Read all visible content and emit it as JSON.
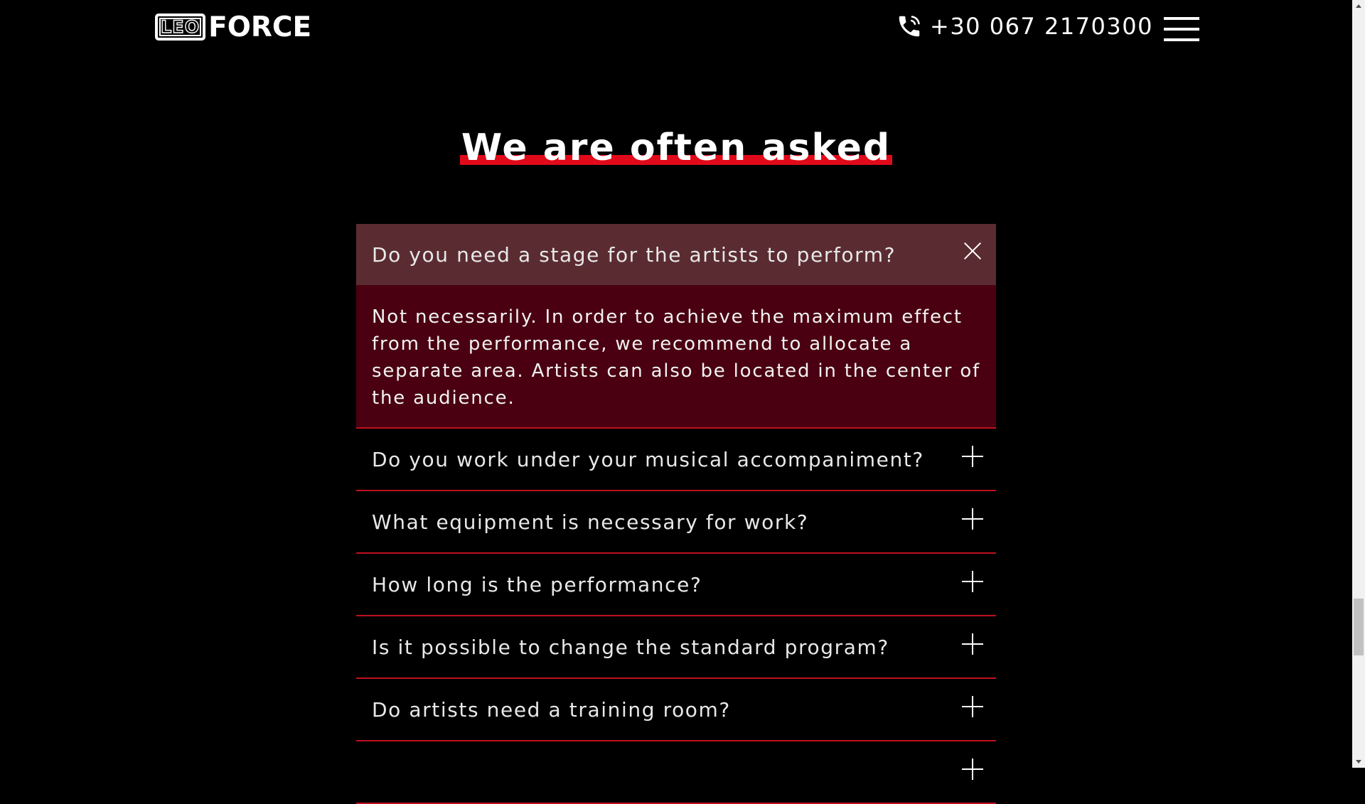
{
  "header": {
    "logo_left": "LEO",
    "logo_right": "FORCE",
    "phone": "+30 067 2170300"
  },
  "section": {
    "title": "We are often asked"
  },
  "faq": [
    {
      "question": "Do you need a stage for the artists to perform?",
      "answer": "Not necessarily. In order to achieve the maximum effect from the performance, we recommend to allocate a separate area. Artists can also be located in the center of the audience.",
      "open": true
    },
    {
      "question": "Do you work under your musical accompaniment?",
      "open": false
    },
    {
      "question": "What equipment is necessary for work?",
      "open": false
    },
    {
      "question": "How long is the performance?",
      "open": false
    },
    {
      "question": "Is it possible to change the standard program?",
      "open": false
    },
    {
      "question": "Do artists need a training room?",
      "open": false
    }
  ],
  "colors": {
    "background": "#000000",
    "accent": "#e10a1a",
    "open_question_bg": "#5a2c31",
    "open_answer_bg": "#4a0010"
  }
}
